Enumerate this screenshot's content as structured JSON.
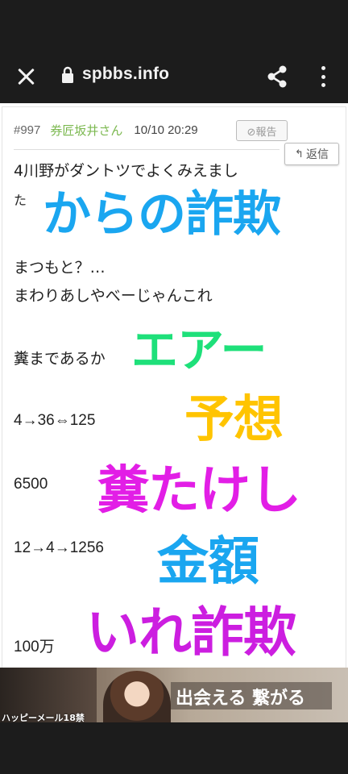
{
  "browser": {
    "url": "spbbs.info",
    "close_icon": "close-icon",
    "lock_icon": "lock-icon",
    "share_icon": "share-icon",
    "menu_icon": "more-vert-icon"
  },
  "post": {
    "number": "#997",
    "author": "券匠坂井さん",
    "date": "10/10 20:29",
    "report_label": "⊘報告",
    "reply_label": "返信",
    "lines": [
      "4川野がダントツでよくみえまし",
      "た",
      "まつもと？…",
      "まわりあしやべーじゃんこれ",
      "糞まであるか",
      "4→36⇔125",
      "6500",
      "12→4→1256",
      "100万"
    ]
  },
  "overlay": {
    "line1": "からの詐欺",
    "line2": "エアー",
    "line3": "予想",
    "line4": "糞たけし",
    "line5": "金額",
    "line6": "いれ詐欺",
    "colors": {
      "blue": "#1aa6f0",
      "green": "#1ee07a",
      "yellow": "#ffc400",
      "magenta": "#e21ee6",
      "cyan": "#1aa6f0",
      "purple": "#cc1ee0"
    }
  },
  "ad": {
    "copy": "出会える 繋がる",
    "label": "ハッピーメール18禁"
  }
}
